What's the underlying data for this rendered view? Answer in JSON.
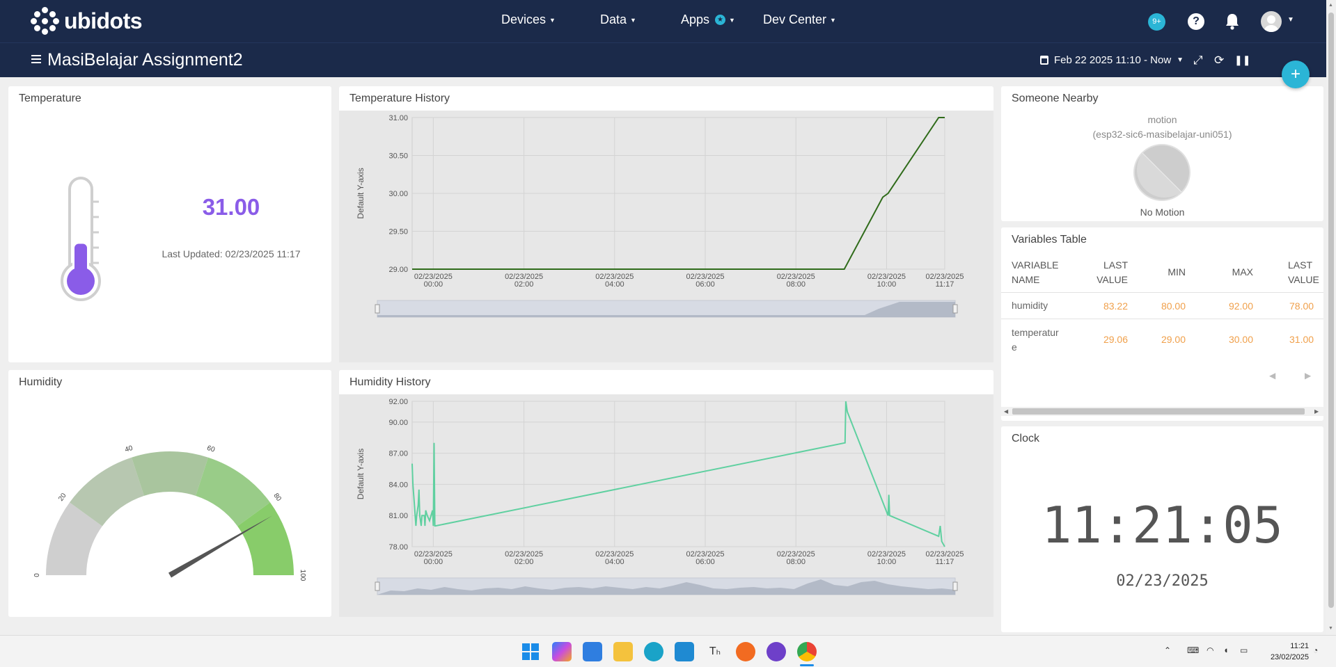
{
  "header": {
    "logo_text": "ubidots",
    "nav": [
      {
        "label": "Devices"
      },
      {
        "label": "Data"
      },
      {
        "label": "Apps"
      },
      {
        "label": "Dev Center"
      }
    ],
    "notifications_badge": "9+",
    "help_label": "?"
  },
  "subbar": {
    "dashboard_title": "MasiBelajar Assignment2",
    "date_range": "Feb 22 2025 11:10 - Now"
  },
  "widgets": {
    "temperature": {
      "title": "Temperature",
      "value": "31.00",
      "last_updated": "Last Updated: 02/23/2025 11:17",
      "fill_fraction": 0.42
    },
    "temperature_history": {
      "title": "Temperature History",
      "y_axis_label": "Default Y-axis"
    },
    "humidity": {
      "title": "Humidity",
      "gauge_value": 83.22,
      "gauge_min": 0,
      "gauge_max": 100,
      "ticks": [
        "0",
        "20",
        "40",
        "60",
        "80",
        "100"
      ]
    },
    "humidity_history": {
      "title": "Humidity History",
      "y_axis_label": "Default Y-axis"
    },
    "someone_nearby": {
      "title": "Someone Nearby",
      "variable": "motion",
      "device": "(esp32-sic6-masibelajar-uni051)",
      "status": "No Motion"
    },
    "variables_table": {
      "title": "Variables Table",
      "headers": [
        "VARIABLE NAME",
        "LAST VALUE",
        "MIN",
        "MAX",
        "LAST VALUE"
      ],
      "rows": [
        {
          "name": "humidity",
          "last": "83.22",
          "min": "80.00",
          "max": "92.00",
          "extra": "78.00"
        },
        {
          "name": "temperature",
          "last": "29.06",
          "min": "29.00",
          "max": "30.00",
          "extra": "31.00"
        }
      ]
    },
    "clock": {
      "title": "Clock",
      "time": "11:21:05",
      "date": "02/23/2025"
    }
  },
  "chart_data": [
    {
      "type": "line",
      "title": "Temperature History",
      "ylabel": "Default Y-axis",
      "ylim": [
        29.0,
        31.0
      ],
      "y_ticks": [
        "31.00",
        "30.50",
        "30.00",
        "29.50",
        "29.00"
      ],
      "x_ticks": [
        {
          "date": "02/23/2025",
          "time": "00:00",
          "t": 0
        },
        {
          "date": "02/23/2025",
          "time": "02:00",
          "t": 120
        },
        {
          "date": "02/23/2025",
          "time": "04:00",
          "t": 240
        },
        {
          "date": "02/23/2025",
          "time": "06:00",
          "t": 360
        },
        {
          "date": "02/23/2025",
          "time": "08:00",
          "t": 480
        },
        {
          "date": "02/23/2025",
          "time": "10:00",
          "t": 600
        },
        {
          "date": "02/23/2025",
          "time": "11:17",
          "t": 677
        }
      ],
      "xlim": [
        -28,
        677
      ],
      "color": "#2f6b1a",
      "series": [
        {
          "points": [
            [
              -28,
              29.0
            ],
            [
              544,
              29.0
            ],
            [
              595,
              29.95
            ],
            [
              602,
              30.0
            ],
            [
              669,
              31.0
            ],
            [
              677,
              31.0
            ]
          ]
        }
      ]
    },
    {
      "type": "line",
      "title": "Humidity History",
      "ylabel": "Default Y-axis",
      "ylim": [
        78.0,
        92.0
      ],
      "y_ticks": [
        "92.00",
        "90.00",
        "87.00",
        "84.00",
        "81.00",
        "78.00"
      ],
      "y_tick_values": [
        92,
        90,
        87,
        84,
        81,
        78
      ],
      "x_ticks": [
        {
          "date": "02/23/2025",
          "time": "00:00",
          "t": 0
        },
        {
          "date": "02/23/2025",
          "time": "02:00",
          "t": 120
        },
        {
          "date": "02/23/2025",
          "time": "04:00",
          "t": 240
        },
        {
          "date": "02/23/2025",
          "time": "06:00",
          "t": 360
        },
        {
          "date": "02/23/2025",
          "time": "08:00",
          "t": 480
        },
        {
          "date": "02/23/2025",
          "time": "10:00",
          "t": 600
        },
        {
          "date": "02/23/2025",
          "time": "11:17",
          "t": 677
        }
      ],
      "xlim": [
        -28,
        677
      ],
      "color": "#5fd0a0",
      "series": [
        {
          "points": [
            [
              -28,
              86.0
            ],
            [
              -27,
              84.0
            ],
            [
              -25,
              82.0
            ],
            [
              -24,
              81.0
            ],
            [
              -23,
              80.0
            ],
            [
              -22,
              81.0
            ],
            [
              -20,
              82.0
            ],
            [
              -19,
              83.5
            ],
            [
              -18,
              81.0
            ],
            [
              -16,
              80.0
            ],
            [
              -15,
              81.0
            ],
            [
              -12,
              81.0
            ],
            [
              -11,
              80.0
            ],
            [
              -10,
              81.5
            ],
            [
              -8,
              81.0
            ],
            [
              -5,
              80.5
            ],
            [
              -1,
              81.5
            ],
            [
              0,
              80.0
            ],
            [
              1,
              88.0
            ],
            [
              2,
              80.0
            ],
            [
              3,
              80.0
            ],
            [
              545,
              88.0
            ],
            [
              546,
              92.0
            ],
            [
              548,
              91.0
            ],
            [
              602,
              81.0
            ],
            [
              603,
              83.0
            ],
            [
              604,
              81.0
            ],
            [
              669,
              79.0
            ],
            [
              671,
              80.0
            ],
            [
              673,
              78.5
            ],
            [
              677,
              78.0
            ]
          ]
        }
      ]
    }
  ]
}
